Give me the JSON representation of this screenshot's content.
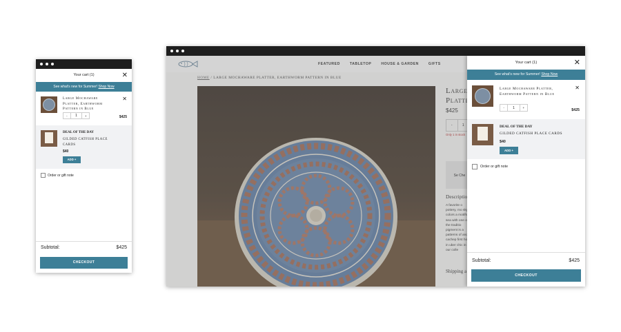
{
  "colors": {
    "accent": "#3d7f97",
    "deal_bg": "#f1f2f4",
    "stock_red": "#b33333"
  },
  "mobile": {
    "header_title": "Your cart (1)",
    "close_icon": "close-icon",
    "banner_text": "See what's new for Summer!",
    "banner_link": "Shop Now",
    "item": {
      "title": "Large Mochaware Platter, Earthworm Pattern in Blue",
      "quantity": "1",
      "minus": "-",
      "plus": "+",
      "price": "$425",
      "remove_icon": "close-icon"
    },
    "deal": {
      "label": "DEAL OF THE DAY",
      "name": "GILDED CATFISH PLACE CARDS",
      "price": "$40",
      "add_label": "ADD +"
    },
    "note_label": "Order or gift note",
    "subtotal_label": "Subtotal:",
    "subtotal_value": "$425",
    "checkout_label": "CHECKOUT"
  },
  "desktop": {
    "nav": [
      "FEATURED",
      "TABLETOP",
      "HOUSE & GARDEN",
      "GIFTS"
    ],
    "breadcrumb_home": "HOME",
    "breadcrumb_sep": " / ",
    "breadcrumb_current": "LARGE MOCHAWARE PLATTER, EARTHWORM PATTERN IN BLUE",
    "product_title": "Large Mochaware Platter, Earth",
    "product_price": "$425",
    "quantity": "1",
    "minus": "-",
    "stock_text": "Only 1 in stock",
    "box_text": "Se Che",
    "description_heading": "Description",
    "description_text": "A favorite o pottery, mo sky colors a motifs - sea with one of the traditio pigment is a patterns of and cachep first home in uber chic in to our colle",
    "shipping_heading": "Shipping a",
    "drawer": {
      "header_title": "Your cart (1)",
      "banner_text": "See what's new for Summer!",
      "banner_link": "Shop Now",
      "item": {
        "title": "Large Mochaware Platter, Earthworm Pattern in Blue",
        "quantity": "1",
        "minus": "-",
        "plus": "+",
        "price": "$425"
      },
      "deal": {
        "label": "DEAL OF THE DAY",
        "name": "GILDED CATFISH PLACE CARDS",
        "price": "$40",
        "add_label": "ADD +"
      },
      "note_label": "Order or gift note",
      "subtotal_label": "Subtotal:",
      "subtotal_value": "$425",
      "checkout_label": "CHECKOUT"
    }
  }
}
